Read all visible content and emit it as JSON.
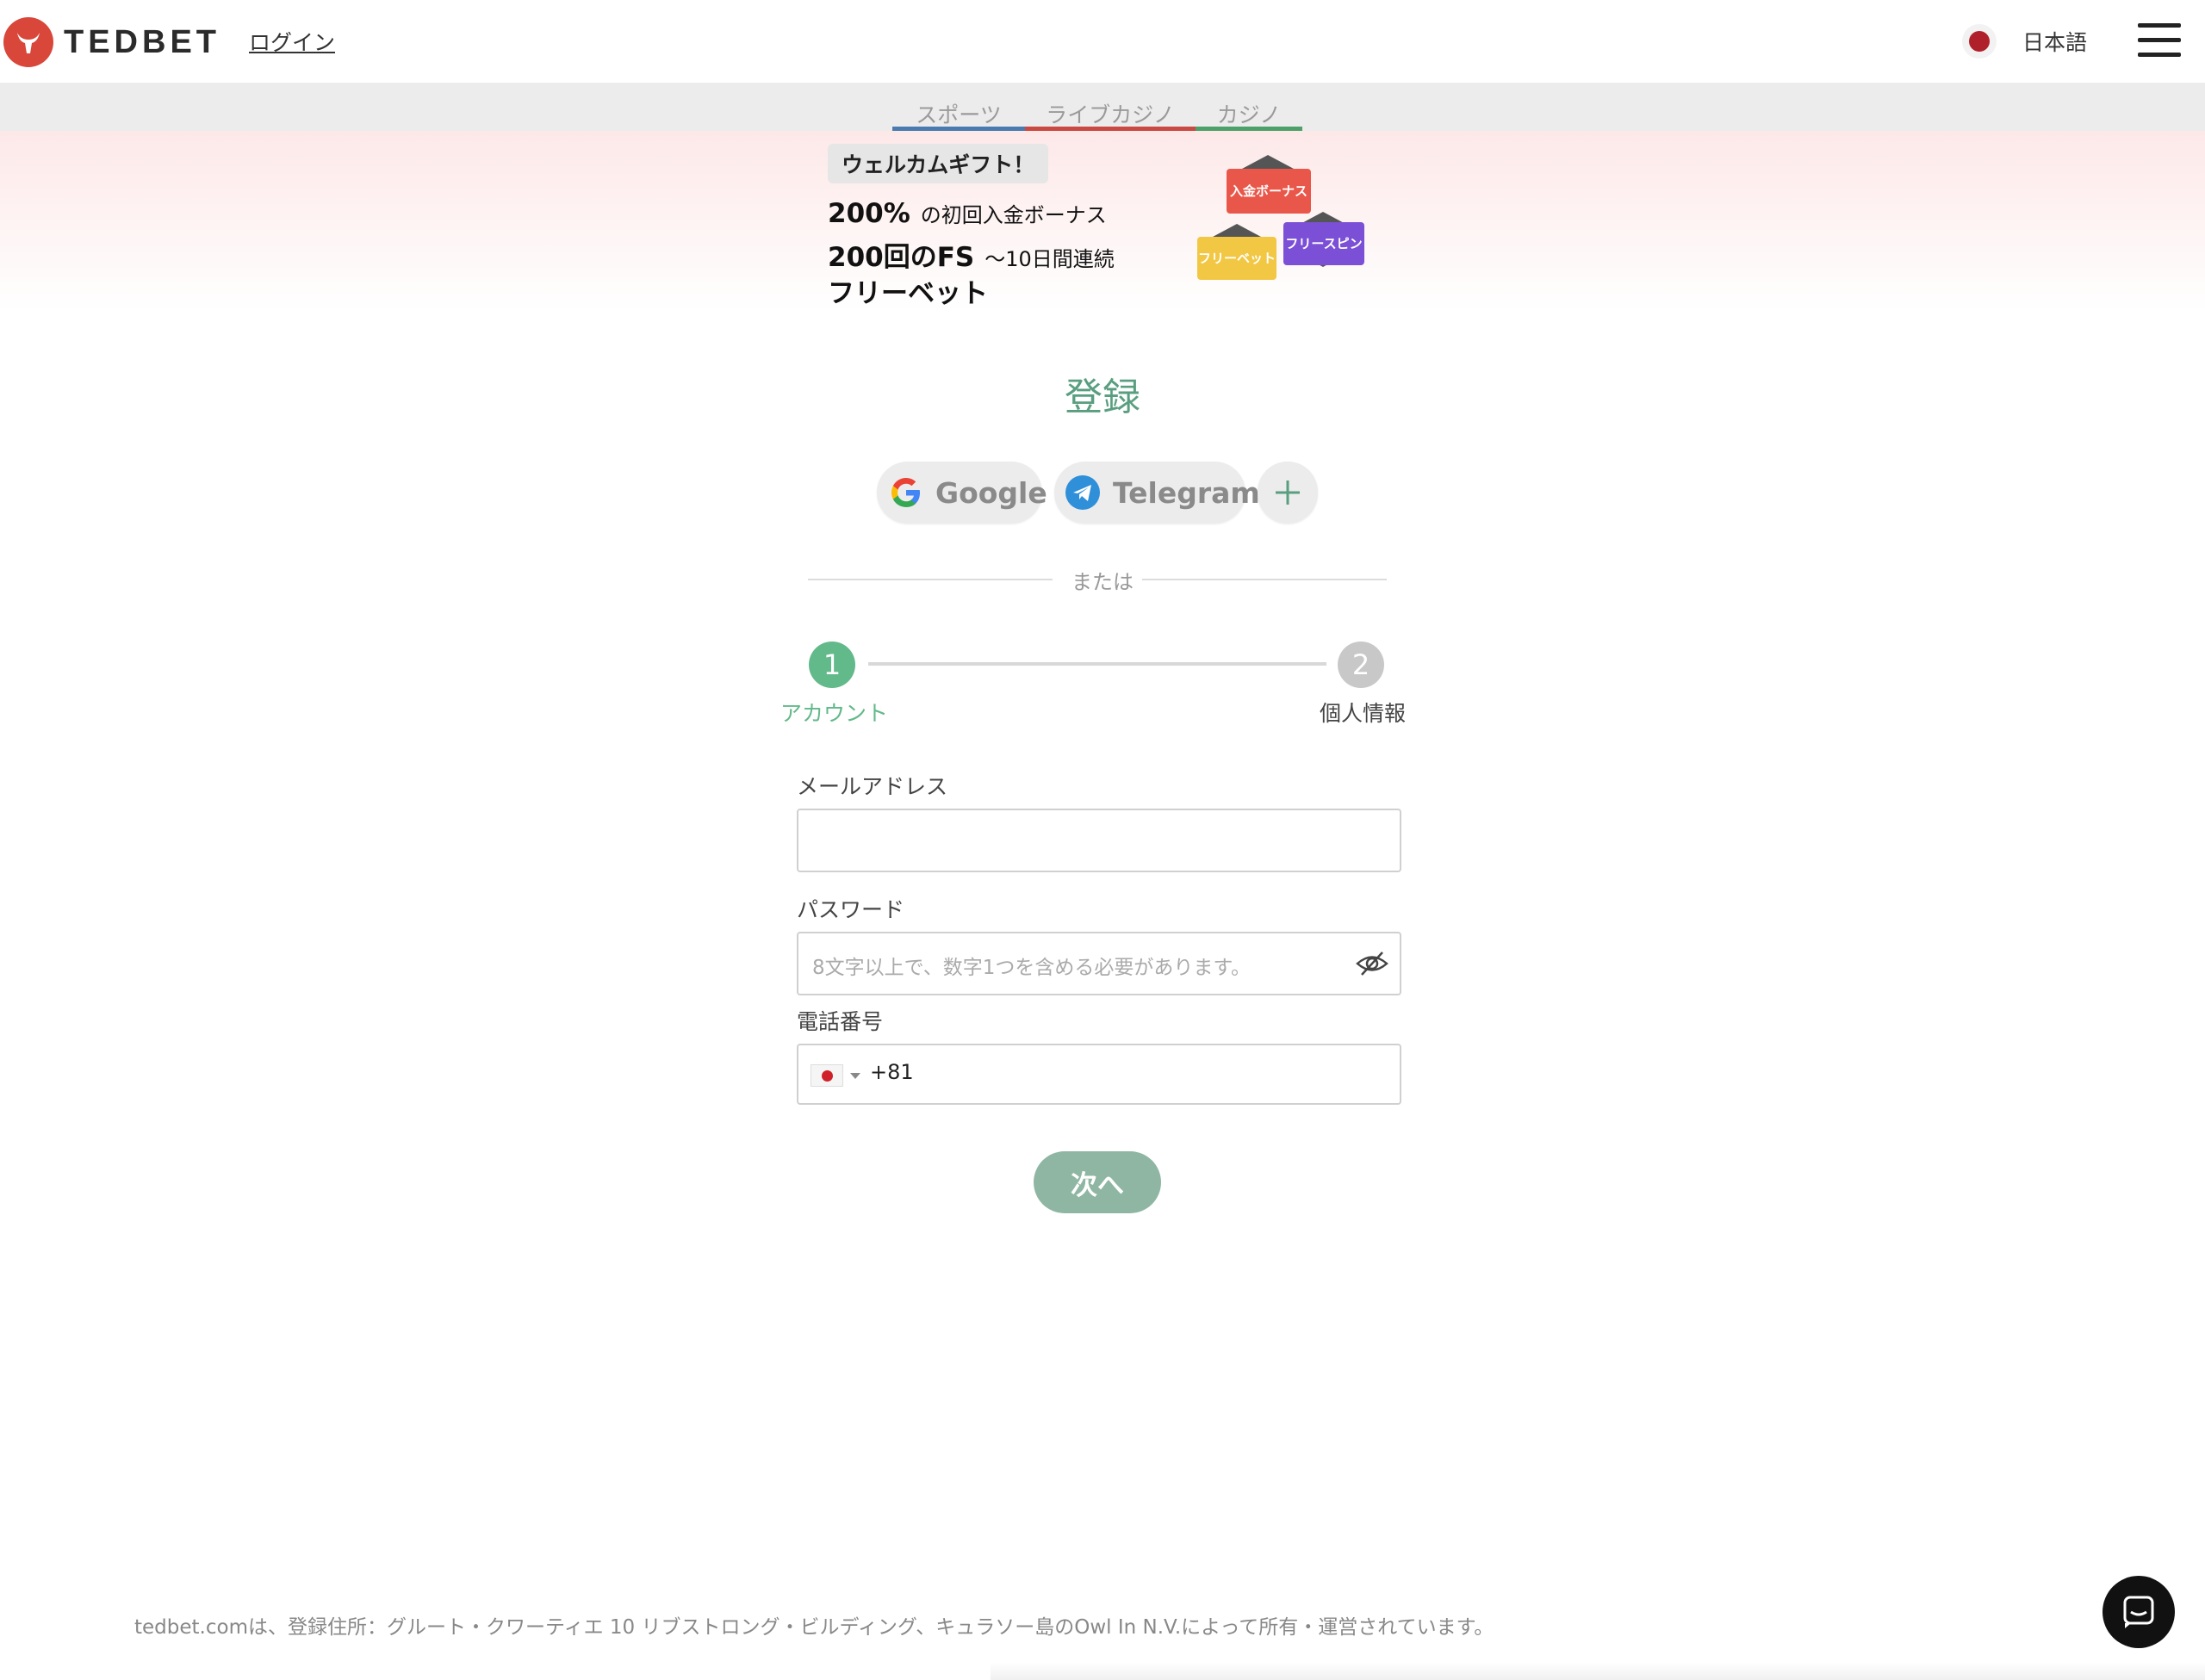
{
  "header": {
    "brand": "TEDBET",
    "login_label": "ログイン",
    "language_label": "日本語"
  },
  "nav": {
    "tabs": [
      {
        "label": "スポーツ",
        "color": "#4a7bb0"
      },
      {
        "label": "ライブカジノ",
        "color": "#c94a42"
      },
      {
        "label": "カジノ",
        "color": "#4ea06b"
      }
    ]
  },
  "banner": {
    "badge": "ウェルカムギフト！",
    "line1_big": "200%",
    "line1_small": "の初回入金ボーナス",
    "line2_big": "200回のFS",
    "line2_small": "〜10日間連続",
    "line3_big": "フリーベット",
    "hex_deposit": "入金ボーナス",
    "hex_freespin": "フリースピン",
    "hex_freebet": "フリーベット"
  },
  "register": {
    "title": "登録",
    "google_label": "Google",
    "telegram_label": "Telegram",
    "divider_text": "または",
    "steps": [
      {
        "number": "1",
        "label": "アカウント"
      },
      {
        "number": "2",
        "label": "個人情報"
      }
    ],
    "email_label": "メールアドレス",
    "password_label": "パスワード",
    "password_placeholder": "8文字以上で、数字1つを含める必要があります。",
    "phone_label": "電話番号",
    "phone_code": "+81",
    "next_label": "次へ"
  },
  "footer": {
    "text": "tedbet.comは、登録住所：グルート・クワーティエ 10 リブストロング・ビルディング、キュラソー島のOwl In N.V.によって所有・運営されています。"
  },
  "colors": {
    "accent": "#5a9e80",
    "brand_red": "#d9463a",
    "step_active": "#62b98a",
    "step_inactive": "#c8c8c8"
  }
}
